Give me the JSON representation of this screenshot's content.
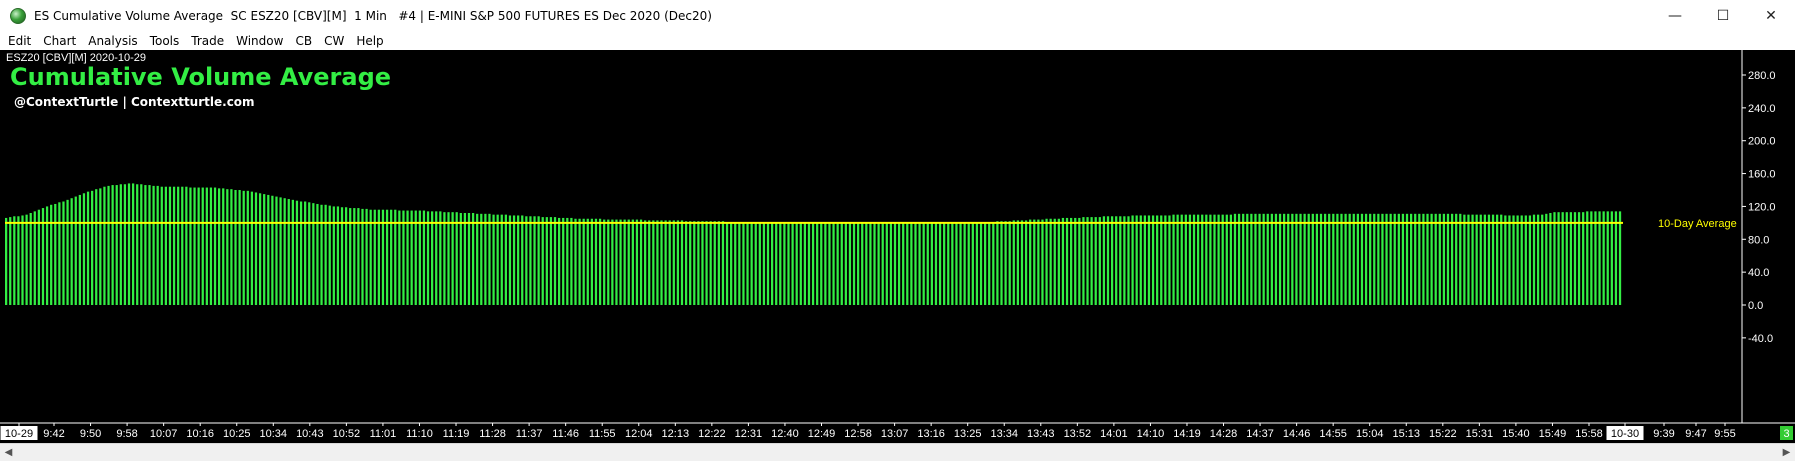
{
  "window": {
    "title": "ES Cumulative Volume Average  SC ESZ20 [CBV][M]  1 Min   #4 | E-MINI S&P 500 FUTURES ES Dec 2020 (Dec20)",
    "minimize": "—",
    "maximize": "☐",
    "close": "✕"
  },
  "menu": [
    "Edit",
    "Chart",
    "Analysis",
    "Tools",
    "Trade",
    "Window",
    "CB",
    "CW",
    "Help"
  ],
  "chart_header": {
    "symbol_date": "ESZ20 [CBV][M] 2020-10-29",
    "title": "Cumulative Volume Average",
    "subtitle": "@ContextTurtle | Contextturtle.com",
    "avg_label": "10-Day Average"
  },
  "colors": {
    "background": "#000000",
    "bars": "#33ee44",
    "average_line": "#ffff00",
    "title": "#33ee44",
    "axis_text": "#ffffff",
    "avg_label": "#ffff00",
    "bottom_badge": "#33cc33"
  },
  "bottom_badge": "3",
  "chart_data": {
    "type": "bar",
    "title": "Cumulative Volume Average",
    "ylim": [
      -60,
      300
    ],
    "y_ticks": [
      "280.0",
      "240.0",
      "200.0",
      "160.0",
      "120.0",
      "80.0",
      "40.0",
      "0.0",
      "-40.0"
    ],
    "y_tick_values": [
      280,
      240,
      200,
      160,
      120,
      80,
      40,
      0,
      -40
    ],
    "average_line": {
      "name": "10-Day Average",
      "value": 100
    },
    "x_labels": [
      "10-29",
      "9:42",
      "9:50",
      "9:58",
      "10:07",
      "10:16",
      "10:25",
      "10:34",
      "10:43",
      "10:52",
      "11:01",
      "11:10",
      "11:19",
      "11:28",
      "11:37",
      "11:46",
      "11:55",
      "12:04",
      "12:13",
      "12:22",
      "12:31",
      "12:40",
      "12:49",
      "12:58",
      "13:07",
      "13:16",
      "13:25",
      "13:34",
      "13:43",
      "13:52",
      "14:01",
      "14:10",
      "14:19",
      "14:28",
      "14:37",
      "14:46",
      "14:55",
      "15:04",
      "15:13",
      "15:22",
      "15:31",
      "15:40",
      "15:49",
      "15:58",
      "10-30",
      "9:39",
      "9:47",
      "9:55"
    ],
    "x_label_highlight": [
      "10-29",
      "10-30"
    ],
    "bar_count": 395,
    "keypoints": [
      [
        0,
        106
      ],
      [
        5,
        110
      ],
      [
        10,
        120
      ],
      [
        15,
        128
      ],
      [
        20,
        138
      ],
      [
        25,
        145
      ],
      [
        30,
        148
      ],
      [
        38,
        144
      ],
      [
        50,
        143
      ],
      [
        60,
        138
      ],
      [
        70,
        128
      ],
      [
        80,
        120
      ],
      [
        90,
        116
      ],
      [
        100,
        115
      ],
      [
        120,
        110
      ],
      [
        140,
        105
      ],
      [
        160,
        103
      ],
      [
        180,
        101
      ],
      [
        200,
        100
      ],
      [
        220,
        100
      ],
      [
        240,
        101
      ],
      [
        255,
        105
      ],
      [
        270,
        108
      ],
      [
        290,
        110
      ],
      [
        310,
        111
      ],
      [
        330,
        111
      ],
      [
        350,
        111
      ],
      [
        370,
        109
      ],
      [
        375,
        110
      ],
      [
        378,
        113
      ],
      [
        394,
        114
      ]
    ]
  }
}
